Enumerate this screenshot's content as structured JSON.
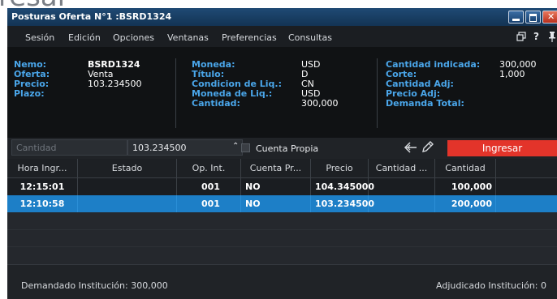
{
  "background": {
    "partial_text": "resar"
  },
  "window": {
    "title": "Posturas Oferta N°1 :BSRD1324",
    "colors": {
      "titlebar": "#133454",
      "accent_label": "#4aa6ea",
      "ingresar": "#e3342a",
      "selected_row": "#1d7fc7"
    }
  },
  "menu": {
    "items": [
      "Sesión",
      "Edición",
      "Opciones",
      "Ventanas",
      "Preferencias",
      "Consultas"
    ],
    "icons": [
      "window-restore-icon",
      "help-icon",
      "pin-icon"
    ],
    "help_glyph": "?"
  },
  "info": {
    "col1": {
      "labels": [
        "Nemo:",
        "Oferta:",
        "Precio:",
        "Plazo:"
      ],
      "values": [
        "BSRD1324",
        "Venta",
        "103.234500",
        ""
      ]
    },
    "col2": {
      "labels": [
        "Moneda:",
        "Título:",
        "Condicion de Liq.:",
        "Moneda de Liq.:",
        "Cantidad:"
      ],
      "values": [
        "USD",
        "D",
        "CN",
        "USD",
        "300,000"
      ]
    },
    "col3": {
      "labels": [
        "Cantidad indicada:",
        "Corte:",
        "Cantidad Adj:",
        "Precio Adj:",
        "Demanda Total:"
      ],
      "values": [
        "300,000",
        "1,000",
        "",
        "",
        ""
      ]
    }
  },
  "controls": {
    "quantity_placeholder": "Cantidad",
    "price_value": "103.234500",
    "spinner_glyph": "⌃",
    "cuenta_propia_label": "Cuenta Propia",
    "cuenta_propia_checked": false,
    "ingresar_label": "Ingresar"
  },
  "table": {
    "columns": [
      "Hora Ingr...",
      "Estado",
      "Op. Int.",
      "Cuenta Pr...",
      "Precio",
      "Cantidad ...",
      "Cantidad",
      ""
    ],
    "rows": [
      {
        "hora": "12:15:01",
        "estado": "",
        "op_int": "001",
        "cuenta": "NO",
        "precio": "104.345000",
        "cantidad_a": "",
        "cantidad": "100,000",
        "selected": false
      },
      {
        "hora": "12:10:58",
        "estado": "",
        "op_int": "001",
        "cuenta": "NO",
        "precio": "103.234500",
        "cantidad_a": "",
        "cantidad": "200,000",
        "selected": true
      }
    ]
  },
  "footer": {
    "left": "Demandado Institución: 300,000",
    "right": "Adjudicado Institución: 0"
  }
}
